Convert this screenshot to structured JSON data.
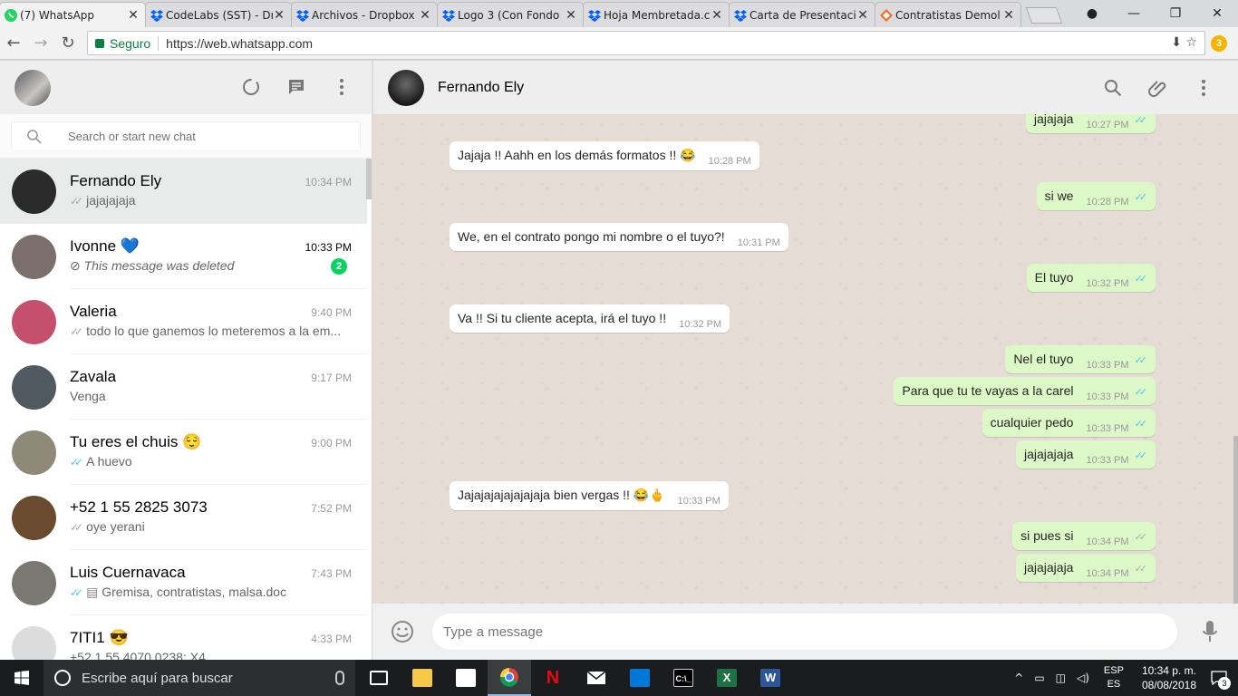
{
  "browser": {
    "tabs": [
      {
        "label": "(7) WhatsApp",
        "active": true,
        "icon": "whatsapp-icon",
        "color": "#25d366"
      },
      {
        "label": "CodeLabs (SST) - Dr",
        "icon": "dropbox-icon",
        "color": "#0061fe"
      },
      {
        "label": "Archivos - Dropbox",
        "icon": "dropbox-icon",
        "color": "#0061fe"
      },
      {
        "label": "Logo 3 (Con Fondo",
        "icon": "dropbox-icon",
        "color": "#0061fe"
      },
      {
        "label": "Hoja Membretada.c",
        "icon": "dropbox-icon",
        "color": "#0061fe"
      },
      {
        "label": "Carta de Presentaci",
        "icon": "dropbox-icon",
        "color": "#0061fe"
      },
      {
        "label": "Contratistas Demol",
        "icon": "kiwi-icon",
        "color": "#f36c21"
      }
    ],
    "secure_label": "Seguro",
    "url": "https://web.whatsapp.com",
    "extension_badge": "3"
  },
  "sidebar": {
    "search_placeholder": "Search or start new chat",
    "chats": [
      {
        "name": "Fernando Ely",
        "time": "10:34 PM",
        "preview": "jajajajaja",
        "tick": "grey",
        "selected": true,
        "avatar_color": "#2b2b2b"
      },
      {
        "name": "Ivonne 💙",
        "time": "10:33 PM",
        "preview": "This message was deleted",
        "deleted": true,
        "unread": "2",
        "avatar_color": "#7b6f6c"
      },
      {
        "name": "Valeria",
        "time": "9:40 PM",
        "preview": "todo lo que ganemos lo meteremos a la em...",
        "tick": "grey",
        "avatar_color": "#c5506d"
      },
      {
        "name": "Zavala",
        "time": "9:17 PM",
        "preview": "Venga",
        "avatar_color": "#505a60"
      },
      {
        "name": "Tu eres el chuis 😌",
        "time": "9:00 PM",
        "preview": "A huevo",
        "tick": "read",
        "avatar_color": "#8f8a78"
      },
      {
        "name": "+52 1 55 2825 3073",
        "time": "7:52 PM",
        "preview": "oye yerani",
        "tick": "grey",
        "avatar_color": "#6a4b2e"
      },
      {
        "name": "Luis Cuernavaca",
        "time": "7:43 PM",
        "preview": "Gremisa, contratistas, malsa.doc",
        "tick": "read",
        "doc": true,
        "avatar_color": "#7a7870"
      },
      {
        "name": "7ITI1 😎",
        "time": "4:33 PM",
        "preview": "+52 1 55 4070 0238: X4",
        "avatar_color": "#dcdcdc"
      }
    ]
  },
  "conversation": {
    "contact": "Fernando Ely",
    "messages": [
      {
        "dir": "out",
        "text": "jajajaja",
        "time": "10:27 PM",
        "tick": "read"
      },
      {
        "dir": "in",
        "text": "Jajaja !! Aahh en los demás formatos !!",
        "emoji": "😂",
        "time": "10:28 PM"
      },
      {
        "dir": "out",
        "text": "si we",
        "time": "10:28 PM",
        "tick": "read"
      },
      {
        "dir": "in",
        "text": "We, en el contrato pongo mi nombre o el tuyo?!",
        "time": "10:31 PM"
      },
      {
        "dir": "out",
        "text": "El tuyo",
        "time": "10:32 PM",
        "tick": "read"
      },
      {
        "dir": "in",
        "text": "Va !! Si tu cliente acepta, irá el tuyo !!",
        "time": "10:32 PM"
      },
      {
        "dir": "out",
        "text": "Nel el tuyo",
        "time": "10:33 PM",
        "tick": "read"
      },
      {
        "dir": "out",
        "text": "Para que tu te vayas a la carel",
        "time": "10:33 PM",
        "tick": "read"
      },
      {
        "dir": "out",
        "text": "cualquier pedo",
        "time": "10:33 PM",
        "tick": "read"
      },
      {
        "dir": "out",
        "text": "jajajajaja",
        "time": "10:33 PM",
        "tick": "read"
      },
      {
        "dir": "in",
        "text": "Jajajajajajajajaja bien vergas !!",
        "emoji": "😂🖕",
        "time": "10:33 PM"
      },
      {
        "dir": "out",
        "text": "si pues si",
        "time": "10:34 PM",
        "tick": "grey"
      },
      {
        "dir": "out",
        "text": "jajajajaja",
        "time": "10:34 PM",
        "tick": "grey"
      }
    ],
    "input_placeholder": "Type a message"
  },
  "taskbar": {
    "search_placeholder": "Escribe aquí para buscar",
    "lang_top": "ESP",
    "lang_bottom": "ES",
    "time": "10:34 p. m.",
    "date": "08/08/2018",
    "notifications": "3"
  },
  "colors": {
    "accent_green": "#09d261",
    "read_tick": "#4fc3f7",
    "outgoing_bubble": "#dcf8c6",
    "chat_bg": "#e5ddd5"
  }
}
